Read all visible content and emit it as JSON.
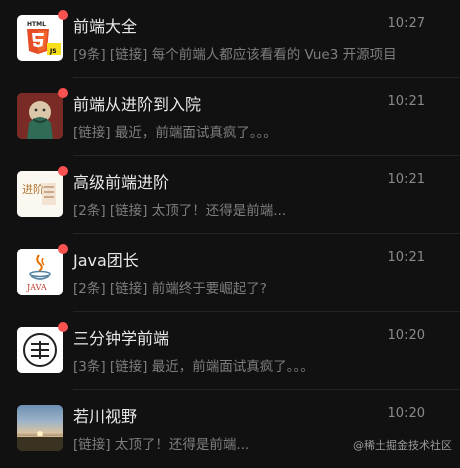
{
  "chats": [
    {
      "name": "前端大全",
      "time": "10:27",
      "preview": "[9条] [链接] 每个前端人都应该看看的 Vue3 开源项目",
      "avatar_icon": "html5-logo-icon",
      "unread": true
    },
    {
      "name": "前端从进阶到入院",
      "time": "10:21",
      "preview": "[链接] 最近，前端面试真疯了。。。",
      "avatar_icon": "artwork-avatar-icon",
      "unread": true
    },
    {
      "name": "高级前端进阶",
      "time": "10:21",
      "preview": "[2条] [链接] 太顶了！还得是前端...",
      "avatar_icon": "advanced-logo-icon",
      "avatar_text": "进阶",
      "unread": true
    },
    {
      "name": "Java团长",
      "time": "10:21",
      "preview": "[2条] [链接] 前端终于要崛起了?",
      "avatar_icon": "java-logo-icon",
      "avatar_text": "JAVA",
      "unread": true
    },
    {
      "name": "三分钟学前端",
      "time": "10:20",
      "preview": "[3条] [链接] 最近，前端面试真疯了。。。",
      "avatar_icon": "three-minutes-logo-icon",
      "unread": true
    },
    {
      "name": "若川视野",
      "time": "10:20",
      "preview": "[链接] 太顶了！还得是前端...",
      "avatar_icon": "sunset-photo-icon",
      "unread": false
    }
  ],
  "watermark": "@稀土掘金技术社区",
  "colors": {
    "background": "#111111",
    "unread_dot": "#fa5151",
    "title": "#e8e8e8",
    "subtext": "#7e7e7e"
  }
}
